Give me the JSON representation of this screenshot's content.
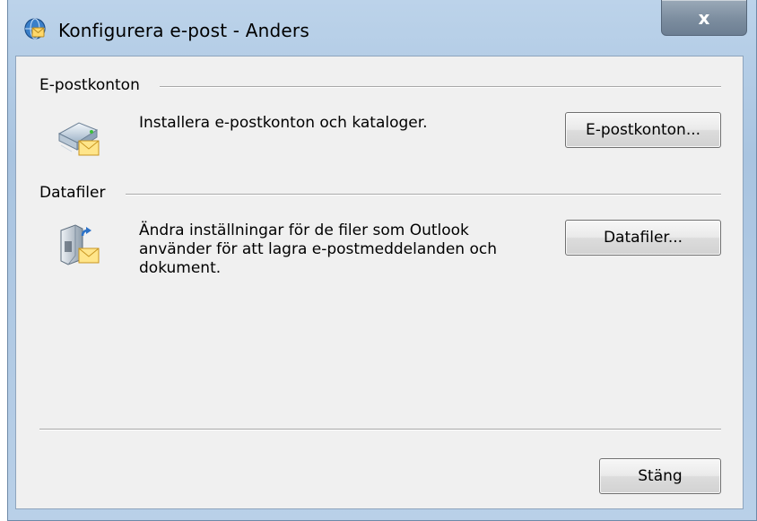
{
  "window": {
    "title": "Konfigurera e-post - Anders",
    "close_label": "x"
  },
  "sections": [
    {
      "header": "E-postkonton",
      "description": "Installera e-postkonton och kataloger.",
      "button_label": "E-postkonton...",
      "icon": "email-accounts-icon"
    },
    {
      "header": "Datafiler",
      "description_lines": [
        "Ändra inställningar för de filer som Outlook",
        "använder för att lagra e-postmeddelanden och",
        "dokument."
      ],
      "button_label": "Datafiler...",
      "icon": "data-files-icon"
    }
  ],
  "footer": {
    "close_button_label": "Stäng"
  }
}
